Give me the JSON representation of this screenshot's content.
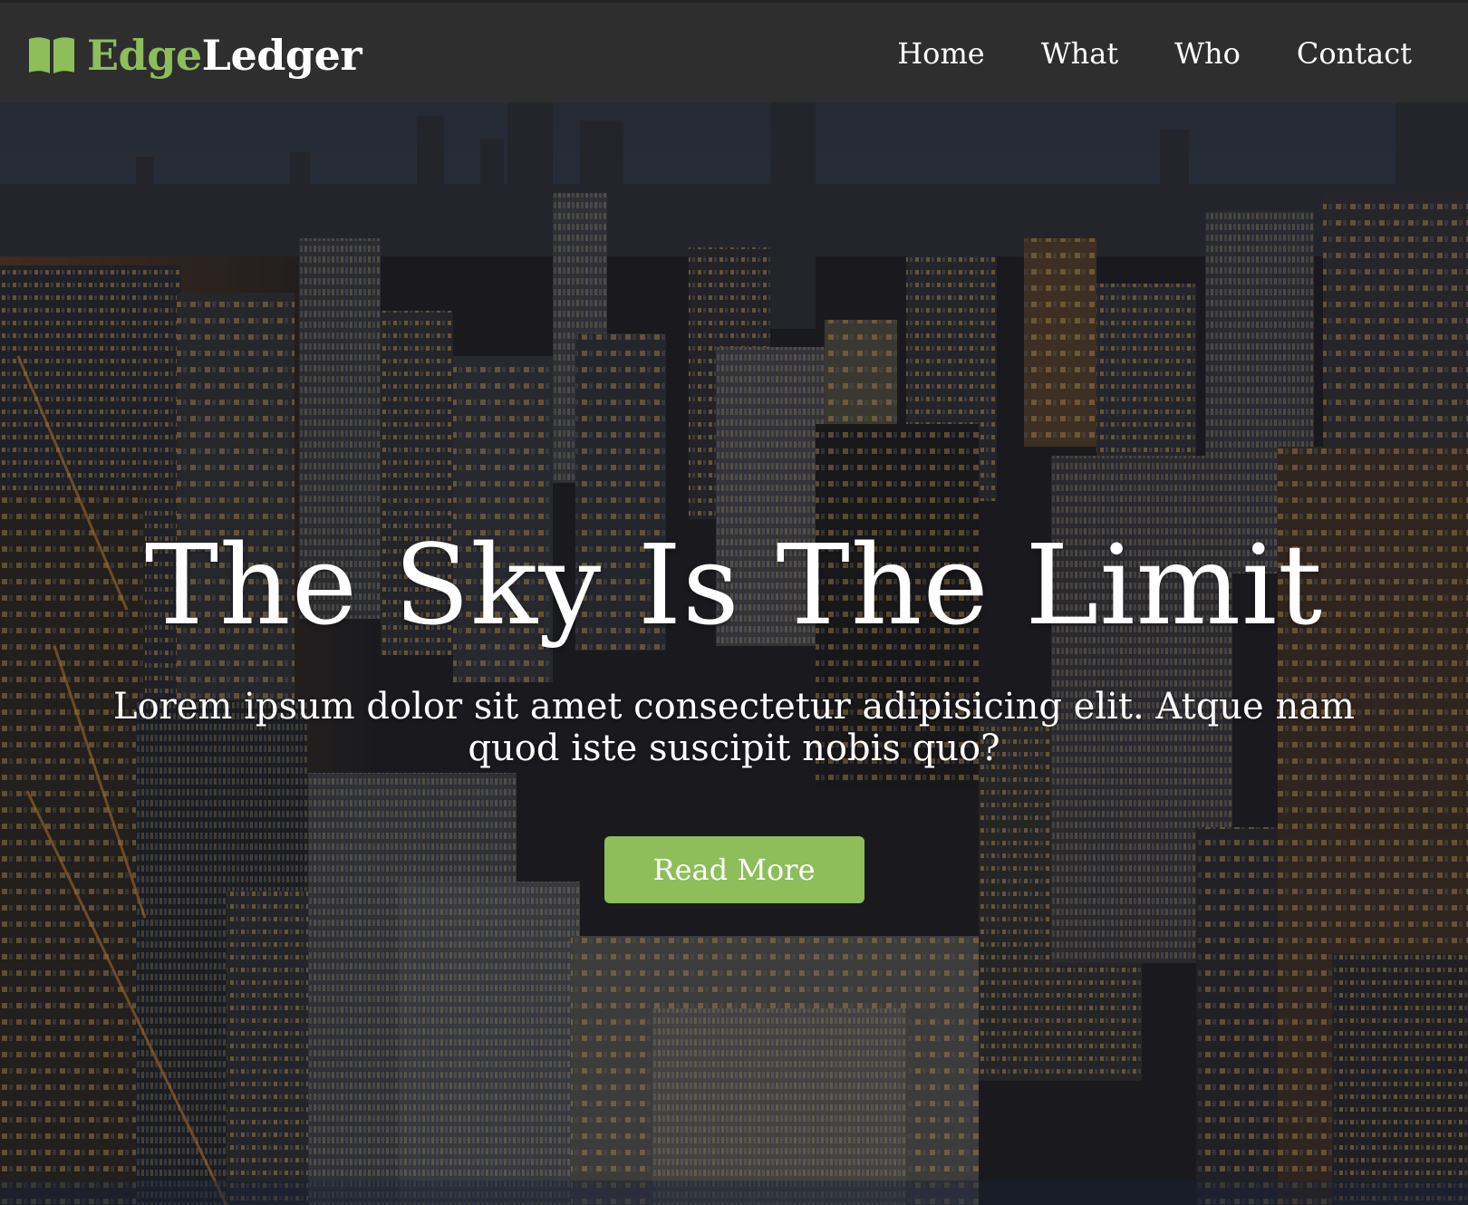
{
  "brand": {
    "part1": "Edge",
    "part2": "Ledger",
    "icon": "open-book-icon",
    "accent_color": "#8dbe5a"
  },
  "nav": {
    "items": [
      {
        "label": "Home"
      },
      {
        "label": "What"
      },
      {
        "label": "Who"
      },
      {
        "label": "Contact"
      }
    ]
  },
  "hero": {
    "title": "The Sky Is The Limit",
    "subtitle": "Lorem ipsum dolor sit amet consectetur adipisicing elit. Atque nam quod iste suscipit nobis quo?",
    "button_label": "Read More",
    "background": "night-city-aerial-photo"
  },
  "colors": {
    "navbar": "#2e2e2e",
    "accent": "#8dbe5a",
    "text": "#ffffff"
  }
}
